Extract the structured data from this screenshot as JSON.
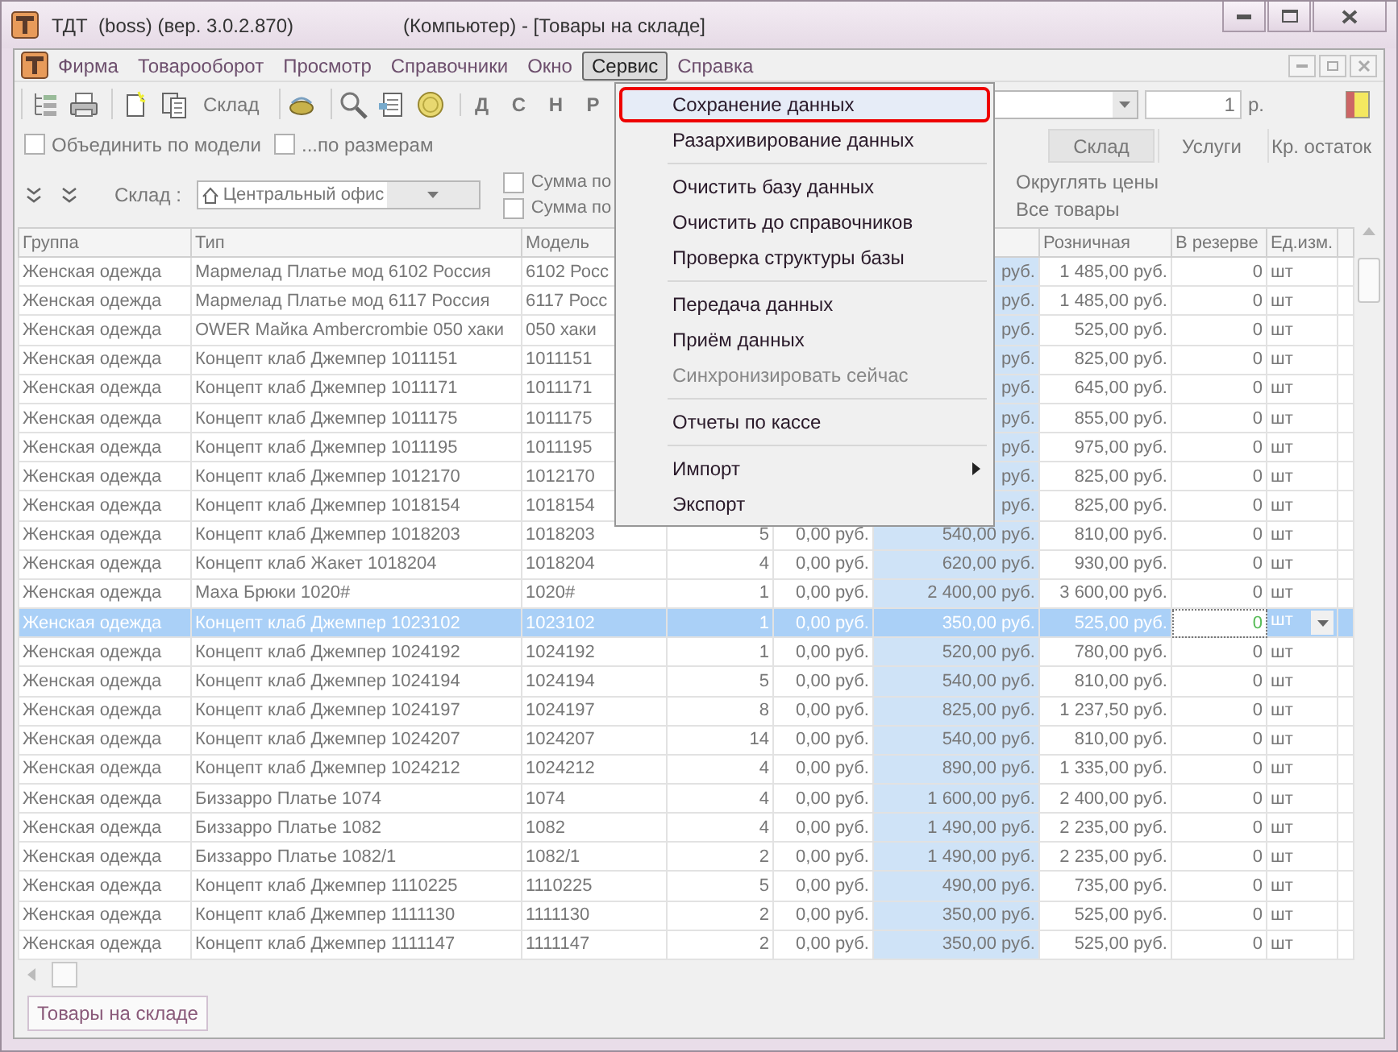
{
  "window": {
    "title": "ТДТ  (boss) (вер. 3.0.2.870)",
    "subtitle": "(Компьютер) - [Товары на складе]"
  },
  "menu_bar": [
    {
      "label": "Фирма",
      "selected": false
    },
    {
      "label": "Товарооборот",
      "selected": false
    },
    {
      "label": "Просмотр",
      "selected": false
    },
    {
      "label": "Справочники",
      "selected": false
    },
    {
      "label": "Окно",
      "selected": false
    },
    {
      "label": "Сервис",
      "selected": true
    },
    {
      "label": "Справка",
      "selected": false
    }
  ],
  "toolbar": {
    "label": "Склад",
    "letters": [
      "Д",
      "С",
      "Н",
      "Р"
    ],
    "price_value": "1",
    "price_unit": "р."
  },
  "options": [
    {
      "label": "Объединить по модели",
      "checked": false
    },
    {
      "label": "...по размерам",
      "checked": false
    }
  ],
  "view_tabs": [
    {
      "label": "Склад",
      "selected": true
    },
    {
      "label": "Услуги",
      "selected": false
    },
    {
      "label": "Кр. остаток",
      "selected": false
    }
  ],
  "filters": {
    "warehouse_label": "Склад :",
    "warehouse": "Центральный офис",
    "checkboxes": [
      {
        "label": "Сумма по",
        "checked": false
      },
      {
        "label": "Сумма по",
        "checked": false
      }
    ],
    "options": [
      "Округлять цены",
      "Все товары"
    ]
  },
  "table": {
    "columns": [
      "Группа",
      "Тип",
      "Модель",
      null,
      null,
      null,
      "Розничная",
      "В резерве",
      "Ед.изм.",
      null
    ],
    "rows": [
      {
        "selected": false,
        "cells": [
          "Женская одежда",
          "Мармелад Платье мод 6102 Россия",
          " 6102 Росс",
          null,
          null,
          "руб.",
          "1 485,00 руб.",
          "0",
          "шт"
        ]
      },
      {
        "selected": false,
        "cells": [
          "Женская одежда",
          "Мармелад Платье мод 6117 Россия",
          " 6117 Росс",
          null,
          null,
          "руб.",
          "1 485,00 руб.",
          "0",
          "шт"
        ]
      },
      {
        "selected": false,
        "cells": [
          "Женская одежда",
          "OWER Майка Ambercrombie 050 хаки",
          "050 хаки",
          null,
          null,
          "руб.",
          "525,00 руб.",
          "0",
          "шт"
        ]
      },
      {
        "selected": false,
        "cells": [
          "Женская одежда",
          "Концепт клаб Джемпер 1011151",
          "1011151",
          null,
          null,
          "руб.",
          "825,00 руб.",
          "0",
          "шт"
        ]
      },
      {
        "selected": false,
        "cells": [
          "Женская одежда",
          "Концепт клаб Джемпер 1011171",
          "1011171",
          null,
          null,
          "руб.",
          "645,00 руб.",
          "0",
          "шт"
        ]
      },
      {
        "selected": false,
        "cells": [
          "Женская одежда",
          "Концепт клаб Джемпер 1011175",
          "1011175",
          null,
          null,
          "руб.",
          "855,00 руб.",
          "0",
          "шт"
        ]
      },
      {
        "selected": false,
        "cells": [
          "Женская одежда",
          "Концепт клаб Джемпер 1011195",
          "1011195",
          null,
          null,
          "руб.",
          "975,00 руб.",
          "0",
          "шт"
        ]
      },
      {
        "selected": false,
        "cells": [
          "Женская одежда",
          "Концепт клаб Джемпер 1012170",
          "1012170",
          null,
          null,
          "руб.",
          "825,00 руб.",
          "0",
          "шт"
        ]
      },
      {
        "selected": false,
        "cells": [
          "Женская одежда",
          "Концепт клаб Джемпер 1018154",
          "1018154",
          null,
          null,
          "руб.",
          "825,00 руб.",
          "0",
          "шт"
        ]
      },
      {
        "selected": false,
        "cells": [
          "Женская одежда",
          "Концепт клаб Джемпер 1018203",
          "1018203",
          "5",
          "0,00 руб.",
          "540,00 руб.",
          "810,00 руб.",
          "0",
          "шт"
        ]
      },
      {
        "selected": false,
        "cells": [
          "Женская одежда",
          "Концепт клаб Жакет 1018204",
          "1018204",
          "4",
          "0,00 руб.",
          "620,00 руб.",
          "930,00 руб.",
          "0",
          "шт"
        ]
      },
      {
        "selected": false,
        "cells": [
          "Женская одежда",
          "Маха Брюки 1020#",
          "1020#",
          "1",
          "0,00 руб.",
          "2 400,00 руб.",
          "3 600,00 руб.",
          "0",
          "шт"
        ]
      },
      {
        "selected": true,
        "cells": [
          "Женская одежда",
          "Концепт клаб Джемпер 1023102",
          "1023102",
          "1",
          "0,00 руб.",
          "350,00 руб.",
          "525,00 руб.",
          "0",
          "шт"
        ]
      },
      {
        "selected": false,
        "cells": [
          "Женская одежда",
          "Концепт клаб Джемпер 1024192",
          "1024192",
          "1",
          "0,00 руб.",
          "520,00 руб.",
          "780,00 руб.",
          "0",
          "шт"
        ]
      },
      {
        "selected": false,
        "cells": [
          "Женская одежда",
          "Концепт клаб Джемпер 1024194",
          "1024194",
          "5",
          "0,00 руб.",
          "540,00 руб.",
          "810,00 руб.",
          "0",
          "шт"
        ]
      },
      {
        "selected": false,
        "cells": [
          "Женская одежда",
          "Концепт клаб Джемпер 1024197",
          "1024197",
          "8",
          "0,00 руб.",
          "825,00 руб.",
          "1 237,50 руб.",
          "0",
          "шт"
        ]
      },
      {
        "selected": false,
        "cells": [
          "Женская одежда",
          "Концепт клаб Джемпер 1024207",
          "1024207",
          "14",
          "0,00 руб.",
          "540,00 руб.",
          "810,00 руб.",
          "0",
          "шт"
        ]
      },
      {
        "selected": false,
        "cells": [
          "Женская одежда",
          "Концепт клаб Джемпер 1024212",
          "1024212",
          "4",
          "0,00 руб.",
          "890,00 руб.",
          "1 335,00 руб.",
          "0",
          "шт"
        ]
      },
      {
        "selected": false,
        "cells": [
          "Женская одежда",
          "Биззарро Платье 1074",
          "1074",
          "4",
          "0,00 руб.",
          "1 600,00 руб.",
          "2 400,00 руб.",
          "0",
          "шт"
        ]
      },
      {
        "selected": false,
        "cells": [
          "Женская одежда",
          "Биззарро Платье 1082",
          "1082",
          "4",
          "0,00 руб.",
          "1 490,00 руб.",
          "2 235,00 руб.",
          "0",
          "шт"
        ]
      },
      {
        "selected": false,
        "cells": [
          "Женская одежда",
          "Биззарро Платье 1082/1",
          "1082/1",
          "2",
          "0,00 руб.",
          "1 490,00 руб.",
          "2 235,00 руб.",
          "0",
          "шт"
        ]
      },
      {
        "selected": false,
        "cells": [
          "Женская одежда",
          "Концепт клаб Джемпер 1110225",
          "1110225",
          "5",
          "0,00 руб.",
          "490,00 руб.",
          "735,00 руб.",
          "0",
          "шт"
        ]
      },
      {
        "selected": false,
        "cells": [
          "Женская одежда",
          "Концепт клаб Джемпер 1111130",
          "1111130",
          "2",
          "0,00 руб.",
          "350,00 руб.",
          "525,00 руб.",
          "0",
          "шт"
        ]
      },
      {
        "selected": false,
        "cells": [
          "Женская одежда",
          "Концепт клаб Джемпер 1111147",
          "1111147",
          "2",
          "0,00 руб.",
          "350,00 руб.",
          "525,00 руб.",
          "0",
          "шт"
        ]
      }
    ]
  },
  "context_menu": {
    "items": [
      {
        "kind": "item",
        "label": "Сохранение данных",
        "highlighted": true,
        "disabled": false,
        "submenu": false
      },
      {
        "kind": "item",
        "label": "Разархивирование данных",
        "highlighted": false,
        "disabled": false,
        "submenu": false
      },
      {
        "kind": "separator"
      },
      {
        "kind": "item",
        "label": "Очистить базу данных",
        "highlighted": false,
        "disabled": false,
        "submenu": false
      },
      {
        "kind": "item",
        "label": "Очистить до справочников",
        "highlighted": false,
        "disabled": false,
        "submenu": false
      },
      {
        "kind": "item",
        "label": "Проверка структуры базы",
        "highlighted": false,
        "disabled": false,
        "submenu": false
      },
      {
        "kind": "separator"
      },
      {
        "kind": "item",
        "label": "Передача данных",
        "highlighted": false,
        "disabled": false,
        "submenu": false
      },
      {
        "kind": "item",
        "label": "Приём данных",
        "highlighted": false,
        "disabled": false,
        "submenu": false
      },
      {
        "kind": "item",
        "label": "Синхронизировать сейчас",
        "highlighted": false,
        "disabled": true,
        "submenu": false
      },
      {
        "kind": "separator"
      },
      {
        "kind": "item",
        "label": "Отчеты по кассе",
        "highlighted": false,
        "disabled": false,
        "submenu": false
      },
      {
        "kind": "separator"
      },
      {
        "kind": "item",
        "label": "Импорт",
        "highlighted": false,
        "disabled": false,
        "submenu": true
      },
      {
        "kind": "item",
        "label": "Экспорт",
        "highlighted": false,
        "disabled": false,
        "submenu": false
      }
    ]
  },
  "document_tabs": [
    {
      "label": "Товары на складе",
      "selected": true
    }
  ]
}
